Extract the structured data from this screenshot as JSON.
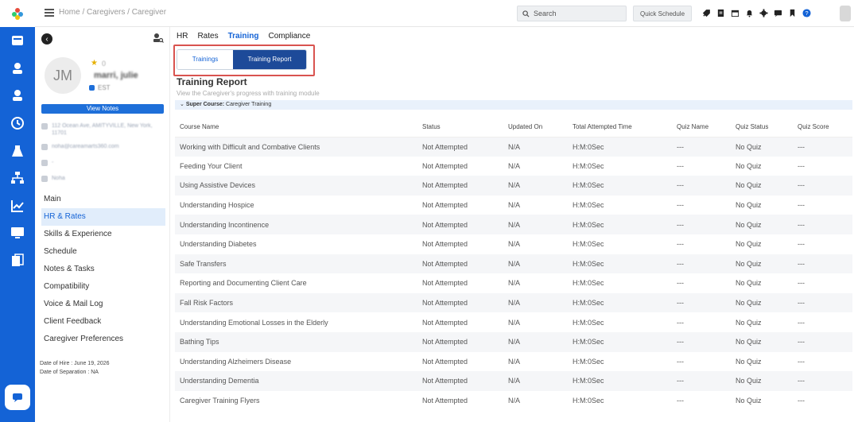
{
  "breadcrumb": {
    "text": "Home / Caregivers / Caregiver"
  },
  "header": {
    "search_label": "Search",
    "quick_schedule_label": "Quick Schedule",
    "icons": [
      "menu-icon",
      "search-icon",
      "rocket-icon",
      "document-icon",
      "calendar-icon",
      "bell-icon",
      "gear-icon",
      "chat-icon",
      "bookmark-icon",
      "help-icon",
      "user-avatar"
    ]
  },
  "rail": {
    "icons": [
      "logo-icon",
      "dashboard-icon",
      "client-icon",
      "caregiver-icon",
      "clock-icon",
      "lab-icon",
      "sitemap-icon",
      "chart-icon",
      "monitor-icon",
      "report-icon",
      "chat-icon"
    ]
  },
  "profile": {
    "initials": "JM",
    "star_count": "0",
    "name": "marri, julie",
    "status": "EST",
    "view_notes_label": "View Notes",
    "address": "112 Ocean Ave, AMITYVILLE, New York, 11701",
    "email": "noha@careamarts360.com",
    "phone": "-",
    "extra": "Noha",
    "date_of_hire": "Date of Hire : June 19, 2026",
    "date_of_separation": "Date of Separation : NA"
  },
  "nav": {
    "items": [
      "Main",
      "HR & Rates",
      "Skills & Experience",
      "Schedule",
      "Notes & Tasks",
      "Compatibility",
      "Voice & Mail Log",
      "Client Feedback",
      "Caregiver Preferences"
    ],
    "active": "HR & Rates"
  },
  "tabs": {
    "items": [
      "HR",
      "Rates",
      "Training",
      "Compliance"
    ],
    "active": "Training"
  },
  "subtabs": {
    "trainings": "Trainings",
    "training_report": "Training Report",
    "active": "Training Report"
  },
  "report": {
    "title": "Training Report",
    "subtitle": "View the Caregiver's progress with training module",
    "super_course_label": "Super Course:",
    "super_course_name": "Caregiver Training",
    "columns": [
      "Course Name",
      "Status",
      "Updated On",
      "Total Attempted Time",
      "Quiz Name",
      "Quiz Status",
      "Quiz Score"
    ],
    "rows": [
      [
        "Working with Difficult and Combative Clients",
        "Not Attempted",
        "N/A",
        "H:M:0Sec",
        "---",
        "No Quiz",
        "---"
      ],
      [
        "Feeding Your Client",
        "Not Attempted",
        "N/A",
        "H:M:0Sec",
        "---",
        "No Quiz",
        "---"
      ],
      [
        "Using Assistive Devices",
        "Not Attempted",
        "N/A",
        "H:M:0Sec",
        "---",
        "No Quiz",
        "---"
      ],
      [
        "Understanding Hospice",
        "Not Attempted",
        "N/A",
        "H:M:0Sec",
        "---",
        "No Quiz",
        "---"
      ],
      [
        "Understanding Incontinence",
        "Not Attempted",
        "N/A",
        "H:M:0Sec",
        "---",
        "No Quiz",
        "---"
      ],
      [
        "Understanding Diabetes",
        "Not Attempted",
        "N/A",
        "H:M:0Sec",
        "---",
        "No Quiz",
        "---"
      ],
      [
        "Safe Transfers",
        "Not Attempted",
        "N/A",
        "H:M:0Sec",
        "---",
        "No Quiz",
        "---"
      ],
      [
        "Reporting and Documenting Client Care",
        "Not Attempted",
        "N/A",
        "H:M:0Sec",
        "---",
        "No Quiz",
        "---"
      ],
      [
        "Fall Risk Factors",
        "Not Attempted",
        "N/A",
        "H:M:0Sec",
        "---",
        "No Quiz",
        "---"
      ],
      [
        "Understanding Emotional Losses in the Elderly",
        "Not Attempted",
        "N/A",
        "H:M:0Sec",
        "---",
        "No Quiz",
        "---"
      ],
      [
        "Bathing Tips",
        "Not Attempted",
        "N/A",
        "H:M:0Sec",
        "---",
        "No Quiz",
        "---"
      ],
      [
        "Understanding Alzheimers Disease",
        "Not Attempted",
        "N/A",
        "H:M:0Sec",
        "---",
        "No Quiz",
        "---"
      ],
      [
        "Understanding Dementia",
        "Not Attempted",
        "N/A",
        "H:M:0Sec",
        "---",
        "No Quiz",
        "---"
      ],
      [
        "Caregiver Training Flyers",
        "Not Attempted",
        "N/A",
        "H:M:0Sec",
        "---",
        "No Quiz",
        "---"
      ]
    ]
  },
  "colors": {
    "primary": "#1463d6",
    "highlight_border": "#d9534f",
    "active_subtab": "#1d4a99"
  }
}
